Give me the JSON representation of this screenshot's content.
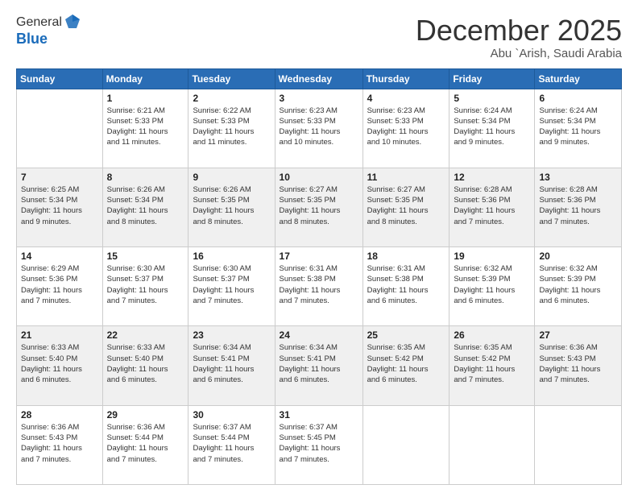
{
  "header": {
    "logo_general": "General",
    "logo_blue": "Blue",
    "month_title": "December 2025",
    "location": "Abu `Arish, Saudi Arabia"
  },
  "days_of_week": [
    "Sunday",
    "Monday",
    "Tuesday",
    "Wednesday",
    "Thursday",
    "Friday",
    "Saturday"
  ],
  "weeks": [
    [
      {
        "day": "",
        "info": ""
      },
      {
        "day": "1",
        "info": "Sunrise: 6:21 AM\nSunset: 5:33 PM\nDaylight: 11 hours\nand 11 minutes."
      },
      {
        "day": "2",
        "info": "Sunrise: 6:22 AM\nSunset: 5:33 PM\nDaylight: 11 hours\nand 11 minutes."
      },
      {
        "day": "3",
        "info": "Sunrise: 6:23 AM\nSunset: 5:33 PM\nDaylight: 11 hours\nand 10 minutes."
      },
      {
        "day": "4",
        "info": "Sunrise: 6:23 AM\nSunset: 5:33 PM\nDaylight: 11 hours\nand 10 minutes."
      },
      {
        "day": "5",
        "info": "Sunrise: 6:24 AM\nSunset: 5:34 PM\nDaylight: 11 hours\nand 9 minutes."
      },
      {
        "day": "6",
        "info": "Sunrise: 6:24 AM\nSunset: 5:34 PM\nDaylight: 11 hours\nand 9 minutes."
      }
    ],
    [
      {
        "day": "7",
        "info": "Sunrise: 6:25 AM\nSunset: 5:34 PM\nDaylight: 11 hours\nand 9 minutes."
      },
      {
        "day": "8",
        "info": "Sunrise: 6:26 AM\nSunset: 5:34 PM\nDaylight: 11 hours\nand 8 minutes."
      },
      {
        "day": "9",
        "info": "Sunrise: 6:26 AM\nSunset: 5:35 PM\nDaylight: 11 hours\nand 8 minutes."
      },
      {
        "day": "10",
        "info": "Sunrise: 6:27 AM\nSunset: 5:35 PM\nDaylight: 11 hours\nand 8 minutes."
      },
      {
        "day": "11",
        "info": "Sunrise: 6:27 AM\nSunset: 5:35 PM\nDaylight: 11 hours\nand 8 minutes."
      },
      {
        "day": "12",
        "info": "Sunrise: 6:28 AM\nSunset: 5:36 PM\nDaylight: 11 hours\nand 7 minutes."
      },
      {
        "day": "13",
        "info": "Sunrise: 6:28 AM\nSunset: 5:36 PM\nDaylight: 11 hours\nand 7 minutes."
      }
    ],
    [
      {
        "day": "14",
        "info": "Sunrise: 6:29 AM\nSunset: 5:36 PM\nDaylight: 11 hours\nand 7 minutes."
      },
      {
        "day": "15",
        "info": "Sunrise: 6:30 AM\nSunset: 5:37 PM\nDaylight: 11 hours\nand 7 minutes."
      },
      {
        "day": "16",
        "info": "Sunrise: 6:30 AM\nSunset: 5:37 PM\nDaylight: 11 hours\nand 7 minutes."
      },
      {
        "day": "17",
        "info": "Sunrise: 6:31 AM\nSunset: 5:38 PM\nDaylight: 11 hours\nand 7 minutes."
      },
      {
        "day": "18",
        "info": "Sunrise: 6:31 AM\nSunset: 5:38 PM\nDaylight: 11 hours\nand 6 minutes."
      },
      {
        "day": "19",
        "info": "Sunrise: 6:32 AM\nSunset: 5:39 PM\nDaylight: 11 hours\nand 6 minutes."
      },
      {
        "day": "20",
        "info": "Sunrise: 6:32 AM\nSunset: 5:39 PM\nDaylight: 11 hours\nand 6 minutes."
      }
    ],
    [
      {
        "day": "21",
        "info": "Sunrise: 6:33 AM\nSunset: 5:40 PM\nDaylight: 11 hours\nand 6 minutes."
      },
      {
        "day": "22",
        "info": "Sunrise: 6:33 AM\nSunset: 5:40 PM\nDaylight: 11 hours\nand 6 minutes."
      },
      {
        "day": "23",
        "info": "Sunrise: 6:34 AM\nSunset: 5:41 PM\nDaylight: 11 hours\nand 6 minutes."
      },
      {
        "day": "24",
        "info": "Sunrise: 6:34 AM\nSunset: 5:41 PM\nDaylight: 11 hours\nand 6 minutes."
      },
      {
        "day": "25",
        "info": "Sunrise: 6:35 AM\nSunset: 5:42 PM\nDaylight: 11 hours\nand 6 minutes."
      },
      {
        "day": "26",
        "info": "Sunrise: 6:35 AM\nSunset: 5:42 PM\nDaylight: 11 hours\nand 7 minutes."
      },
      {
        "day": "27",
        "info": "Sunrise: 6:36 AM\nSunset: 5:43 PM\nDaylight: 11 hours\nand 7 minutes."
      }
    ],
    [
      {
        "day": "28",
        "info": "Sunrise: 6:36 AM\nSunset: 5:43 PM\nDaylight: 11 hours\nand 7 minutes."
      },
      {
        "day": "29",
        "info": "Sunrise: 6:36 AM\nSunset: 5:44 PM\nDaylight: 11 hours\nand 7 minutes."
      },
      {
        "day": "30",
        "info": "Sunrise: 6:37 AM\nSunset: 5:44 PM\nDaylight: 11 hours\nand 7 minutes."
      },
      {
        "day": "31",
        "info": "Sunrise: 6:37 AM\nSunset: 5:45 PM\nDaylight: 11 hours\nand 7 minutes."
      },
      {
        "day": "",
        "info": ""
      },
      {
        "day": "",
        "info": ""
      },
      {
        "day": "",
        "info": ""
      }
    ]
  ]
}
